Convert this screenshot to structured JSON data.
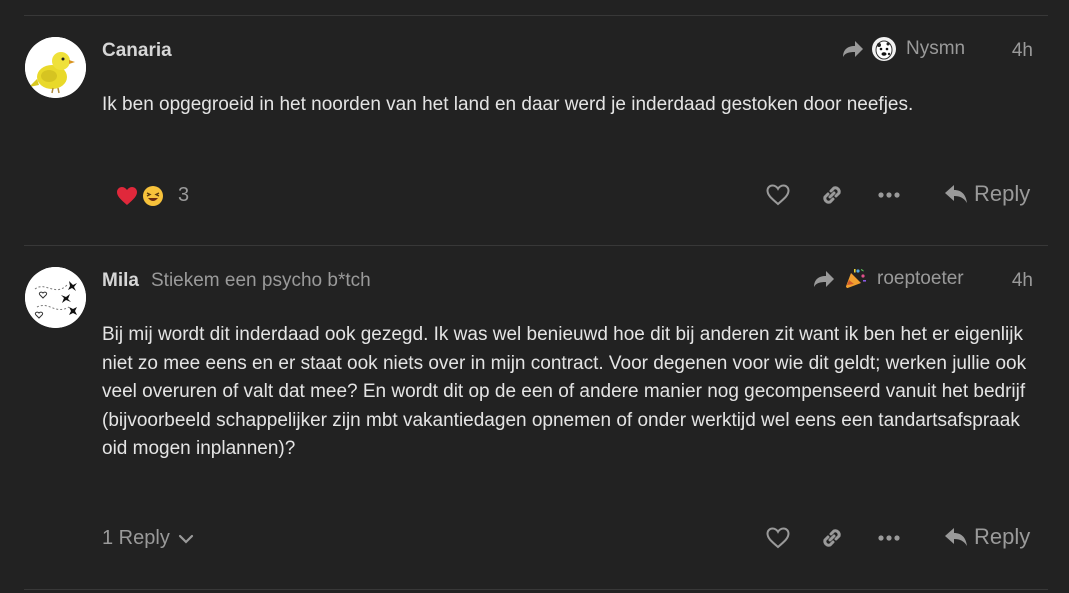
{
  "posts": [
    {
      "username": "Canaria",
      "user_title": "",
      "reply_to": "Nysmn",
      "time": "4h",
      "body": "Ik ben opgegroeid in het noorden van het land en daar werd je inderdaad gestoken door neefjes.",
      "reaction_count": "3",
      "reactions": [
        "heart-emoji",
        "laughing-emoji"
      ],
      "reply_label": "Reply"
    },
    {
      "username": "Mila",
      "user_title": "Stiekem een psycho b*tch",
      "reply_to": "roeptoeter",
      "time": "4h",
      "body": "Bij mij wordt dit inderdaad ook gezegd. Ik was wel benieuwd hoe dit bij anderen zit want ik ben het er eigenlijk niet zo mee eens en er staat ook niets over in mijn contract. Voor degenen voor wie dit geldt; werken jullie ook veel overuren of valt dat mee? En wordt dit op de een of andere manier nog gecompenseerd vanuit het bedrijf (bijvoorbeeld schappelijker zijn mbt vakantiedagen opnemen of onder werktijd wel eens een tandartsafspraak oid mogen inplannen)?",
      "replies_label": "1 Reply",
      "reply_label": "Reply"
    }
  ],
  "colors": {
    "background": "#222222",
    "text": "#e4e4e4",
    "muted": "#9a9a9a",
    "heart": "#e0283b"
  }
}
